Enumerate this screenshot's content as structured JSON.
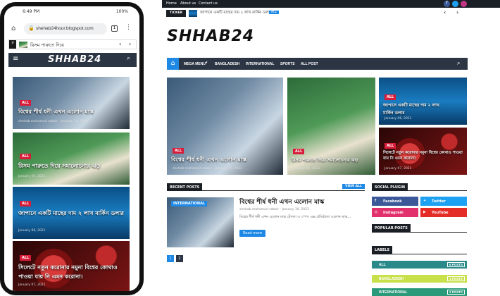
{
  "phone": {
    "status_time": "6:49 PM",
    "status_right": "100%",
    "url": "shehab24hour.blogspot.com",
    "tab_count": "1",
    "ticker_text": "রিসম পারুতে দিয়ে",
    "logo": "SHHAB24",
    "posts": [
      {
        "badge": "ALL",
        "title": "বিশ্বের শীর্ষ ধনী এখন এলোন মাস্ক",
        "author": "shehab mahamud sabbir",
        "date": "January 10, 2021"
      },
      {
        "badge": "ALL",
        "title": "রিসম পারুতে দিয়ে সমালোচনার ঝড়",
        "date": "January 06, 2021"
      },
      {
        "badge": "ALL",
        "title": "জাপানে একটি মাছের দাম ২ লাখ মার্কিন ডলার",
        "date": "January 06, 2021"
      },
      {
        "badge": "ALL",
        "title": "সিলেটে নতুন করোনার নমুনা বিশ্বের কোথাও পাওয়া যায় নি এমন করোনা।",
        "date": "January 07, 2021"
      }
    ]
  },
  "site": {
    "top_links": [
      "Home",
      "About us",
      "Contact us"
    ],
    "ticker_label": "TICKER",
    "ticker_text": "জাপানে একটি মাছের দাম ২ লাখ মার্কিন ডলার",
    "ticker_badge": "ALL",
    "logo": "SHHAB24",
    "nav": [
      "MEGA MENU",
      "BANGLADESH",
      "INTERNATIONAL",
      "SPORTS",
      "ALL POST"
    ],
    "hero": {
      "big": {
        "badge": "ALL",
        "title": "বিশ্বের শীর্ষ ধনী এখন এলোন মাস্ক",
        "author": "shehab mahamud sabbir",
        "date": "January 10, 2021"
      },
      "mid": {
        "badge": "ALL",
        "title": "রিসম পারুতে দিয়ে সমালোচনার ঝড়",
        "date": "January 06, 2021"
      },
      "right1": {
        "badge": "ALL",
        "title": "জাপানে একটি মাছের দাম ২ লাখ মার্কিন ডলার",
        "date": "January 06, 2021"
      },
      "right2": {
        "badge": "ALL",
        "title": "সিলেটে নতুন করোনার নমুনা বিশ্বের কোথাও পাওয়া যায় নি এমন করোনা।",
        "date": "January 07, 2021"
      }
    },
    "recent": {
      "heading": "RECENT POSTS",
      "view_all": "VIEW ALL",
      "post": {
        "badge": "INTERNATIONAL",
        "title": "বিশ্বের শীর্ষ ধনী এখন এলোন মাস্ক",
        "author": "shehab mahamud sabbir",
        "date": "January 10, 2021",
        "snippet": "বিশ্বের শীর্ষ ধনী এখন এলোন মাস্ক টেসলা ও স্পেস এক্স প্রতিষ্ঠাতা এলোন মাস্ক…",
        "read_more": "Read more"
      },
      "pages": [
        "1",
        "2"
      ]
    },
    "sidebar": {
      "social_heading": "SOCIAL PLUGIN",
      "social": [
        {
          "name": "Facebook",
          "color": "#3b5998"
        },
        {
          "name": "Twitter",
          "color": "#1da1f2"
        },
        {
          "name": "Instagram",
          "color": "#e1306c"
        },
        {
          "name": "YouTube",
          "color": "#e52d27"
        }
      ],
      "popular_heading": "POPULAR POSTS",
      "labels_heading": "LABELS",
      "labels": [
        {
          "name": "ALL",
          "count": "6 POSTS",
          "color": "#2a8a8a"
        },
        {
          "name": "BANGLADESH",
          "count": "1 POSTS",
          "color": "#c8e04a"
        },
        {
          "name": "INTERNATIONAL",
          "count": "2 POSTS",
          "color": "#2a9a7a"
        }
      ]
    }
  },
  "colors": {
    "accent": "#1e88e5",
    "nav_bg": "#2b3543",
    "badge": "#d81d3a"
  }
}
